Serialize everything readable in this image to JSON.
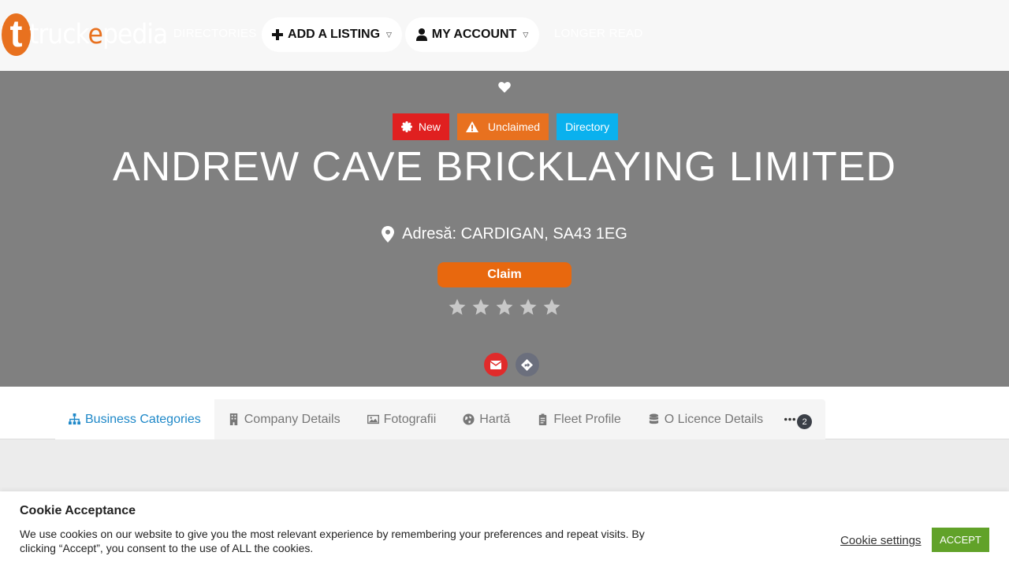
{
  "header": {
    "logo_letter": "t",
    "logo_text_start": "truck",
    "logo_text_e": "e",
    "logo_text_end": "pedia",
    "nav_directories": "DIRECTORIES",
    "nav_add_listing": "ADD A LISTING",
    "nav_my_account": "MY ACCOUNT",
    "nav_longer_read": "LONGER READ"
  },
  "hero": {
    "badges": {
      "new": "New",
      "unclaimed": "Unclaimed",
      "directory": "Directory"
    },
    "title": "ANDREW CAVE BRICKLAYING LIMITED",
    "address": "Adresă: CARDIGAN, SA43 1EG",
    "claim_label": "Claim",
    "rating": 0,
    "rating_max": 5
  },
  "tabs": {
    "business_categories": "Business Categories",
    "company_details": "Company Details",
    "fotografii": "Fotografii",
    "harta": "Hartă",
    "fleet_profile": "Fleet Profile",
    "o_licence": "O Licence Details",
    "more_count": "2"
  },
  "cookie": {
    "title": "Cookie Acceptance",
    "text": "We use cookies on our website to give you the most relevant experience by remembering your preferences and repeat visits. By clicking “Accept”, you consent to the use of ALL the cookies.",
    "settings_label": "Cookie settings",
    "accept_label": "ACCEPT"
  },
  "colors": {
    "brand_orange": "#e8711f",
    "hero_bg": "#808080",
    "badge_new": "#e02020",
    "badge_directory": "#0ab1ee",
    "tab_active": "#1e88c8",
    "accept_green": "#61a229"
  }
}
